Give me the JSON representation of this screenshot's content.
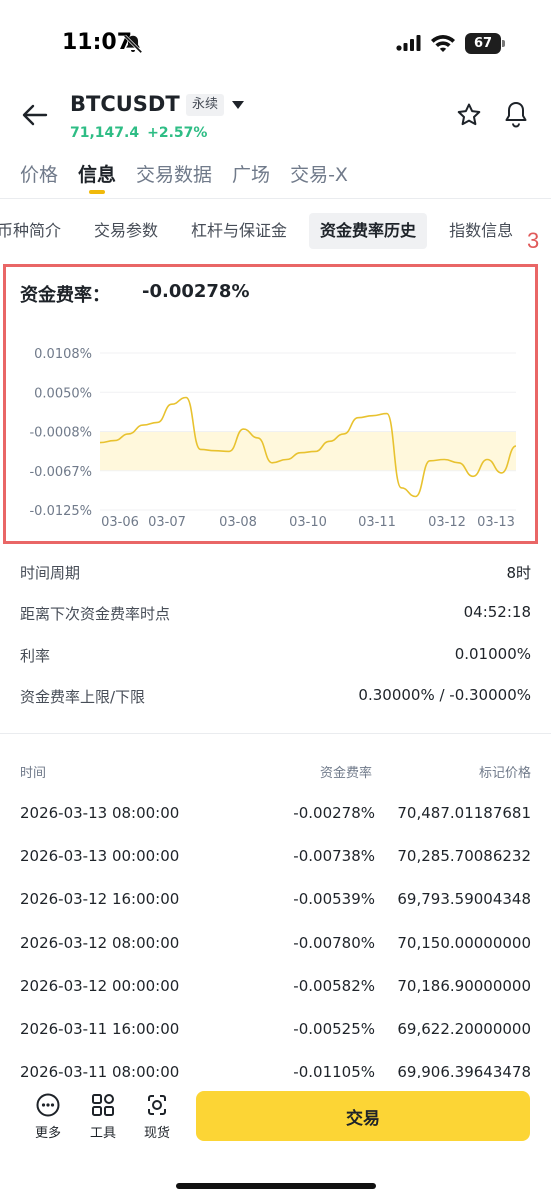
{
  "status": {
    "time": "11:07",
    "battery": "67"
  },
  "header": {
    "symbol": "BTCUSDT",
    "contract_type": "永续",
    "last_price": "71,147.4",
    "change": "+2.57%"
  },
  "main_tabs": [
    {
      "label": "价格"
    },
    {
      "label": "信息"
    },
    {
      "label": "交易数据"
    },
    {
      "label": "广场"
    },
    {
      "label": "交易-X"
    }
  ],
  "sub_tabs": [
    {
      "label": "币种简介"
    },
    {
      "label": "交易参数"
    },
    {
      "label": "杠杆与保证金"
    },
    {
      "label": "资金费率历史"
    },
    {
      "label": "指数信息"
    }
  ],
  "annotation": "3",
  "funding": {
    "label": "资金费率：",
    "value": "-0.00278%"
  },
  "chart_data": {
    "type": "line",
    "y_ticks": [
      "0.0108%",
      "0.0050%",
      "-0.0008%",
      "-0.0067%",
      "-0.0125%"
    ],
    "x_ticks": [
      "03-06",
      "03-07",
      "03-08",
      "03-10",
      "03-11",
      "03-12",
      "03-13"
    ],
    "ylim": [
      -0.0125,
      0.0108
    ],
    "series": [
      {
        "color": "#e8c22f",
        "values": [
          -0.0025,
          -0.0022,
          -0.0012,
          0.0001,
          0.0005,
          0.0032,
          0.0042,
          -0.0035,
          -0.0037,
          -0.0038,
          -0.0005,
          -0.0018,
          -0.0055,
          -0.005,
          -0.004,
          -0.0038,
          -0.0023,
          -0.0012,
          0.0012,
          0.0015,
          0.0018,
          -0.0092,
          -0.0105,
          -0.0052,
          -0.005,
          -0.0055,
          -0.0075,
          -0.005,
          -0.007,
          -0.003
        ]
      }
    ],
    "grid": true
  },
  "info": [
    {
      "label": "时间周期",
      "value": "8时"
    },
    {
      "label": "距离下次资金费率时点",
      "value": "04:52:18"
    },
    {
      "label": "利率",
      "value": "0.01000%"
    },
    {
      "label": "资金费率上限/下限",
      "value": "0.30000% / -0.30000%"
    }
  ],
  "table": {
    "headers": {
      "time": "时间",
      "rate": "资金费率",
      "mark": "标记价格"
    },
    "rows": [
      {
        "time": "2026-03-13 08:00:00",
        "rate": "-0.00278%",
        "mark": "70,487.01187681"
      },
      {
        "time": "2026-03-13 00:00:00",
        "rate": "-0.00738%",
        "mark": "70,285.70086232"
      },
      {
        "time": "2026-03-12 16:00:00",
        "rate": "-0.00539%",
        "mark": "69,793.59004348"
      },
      {
        "time": "2026-03-12 08:00:00",
        "rate": "-0.00780%",
        "mark": "70,150.00000000"
      },
      {
        "time": "2026-03-12 00:00:00",
        "rate": "-0.00582%",
        "mark": "70,186.90000000"
      },
      {
        "time": "2026-03-11 16:00:00",
        "rate": "-0.00525%",
        "mark": "69,622.20000000"
      },
      {
        "time": "2026-03-11 08:00:00",
        "rate": "-0.01105%",
        "mark": "69,906.39643478"
      }
    ]
  },
  "bottom": {
    "more": "更多",
    "tools": "工具",
    "spot": "现货",
    "trade": "交易"
  }
}
